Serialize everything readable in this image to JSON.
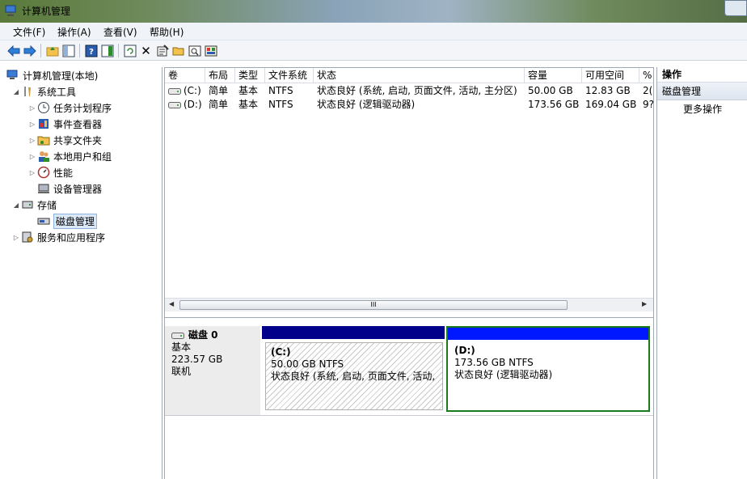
{
  "window": {
    "title": "计算机管理"
  },
  "menu": [
    "文件(F)",
    "操作(A)",
    "查看(V)",
    "帮助(H)"
  ],
  "toolbar": {
    "back": "back-arrow-icon",
    "forward": "forward-arrow-icon",
    "close_glyph": "✕"
  },
  "tree": {
    "root": "计算机管理(本地)",
    "system_tools": "系统工具",
    "task_scheduler": "任务计划程序",
    "event_viewer": "事件查看器",
    "shared_folders": "共享文件夹",
    "local_users": "本地用户和组",
    "performance": "性能",
    "device_manager": "设备管理器",
    "storage": "存储",
    "disk_management": "磁盘管理",
    "services": "服务和应用程序"
  },
  "volumes": {
    "columns": [
      "卷",
      "布局",
      "类型",
      "文件系统",
      "状态",
      "容量",
      "可用空间",
      "%"
    ],
    "rows": [
      {
        "volume": "(C:)",
        "layout": "简单",
        "type": "基本",
        "fs": "NTFS",
        "status": "状态良好 (系统, 启动, 页面文件, 活动, 主分区)",
        "capacity": "50.00 GB",
        "free": "12.83 GB",
        "pct": "2("
      },
      {
        "volume": "(D:)",
        "layout": "简单",
        "type": "基本",
        "fs": "NTFS",
        "status": "状态良好 (逻辑驱动器)",
        "capacity": "173.56 GB",
        "free": "169.04 GB",
        "pct": "9?"
      }
    ],
    "scroll_grip": "III"
  },
  "disk": {
    "name": "磁盘 0",
    "kind": "基本",
    "size": "223.57 GB",
    "state": "联机",
    "partitions": [
      {
        "label": "(C:)",
        "size_fs": "50.00 GB NTFS",
        "status": "状态良好 (系统, 启动, 页面文件, 活动, 主"
      },
      {
        "label": "(D:)",
        "size_fs": "173.56 GB NTFS",
        "status": "状态良好 (逻辑驱动器)"
      }
    ]
  },
  "actions": {
    "header": "操作",
    "section": "磁盘管理",
    "more": "更多操作"
  }
}
